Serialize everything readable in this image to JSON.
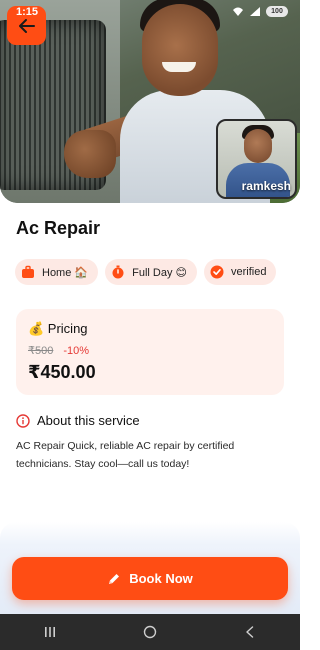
{
  "status_bar": {
    "time": "1:15",
    "battery": "100"
  },
  "hero": {
    "back_icon": "arrow-left-icon",
    "worker_name": "ramkesh"
  },
  "service": {
    "title": "Ac Repair",
    "chips": [
      {
        "icon": "briefcase-icon",
        "label": "Home 🏠"
      },
      {
        "icon": "timer-icon",
        "label": "Full Day 😊"
      },
      {
        "icon": "verified-badge-icon",
        "label": "verified"
      }
    ]
  },
  "pricing": {
    "heading": "💰 Pricing",
    "old_price": "₹500",
    "discount": "-10%",
    "final_price": "₹450.00"
  },
  "about": {
    "heading": "About this service",
    "text": "AC Repair Quick, reliable AC repair by certified technicians. Stay cool—call us today!"
  },
  "cta": {
    "label": "Book Now",
    "icon": "pencil-icon"
  },
  "colors": {
    "accent": "#ff4d14",
    "chip_bg": "#fde9e4",
    "card_bg": "#fff1ed",
    "discount": "#e53935"
  }
}
